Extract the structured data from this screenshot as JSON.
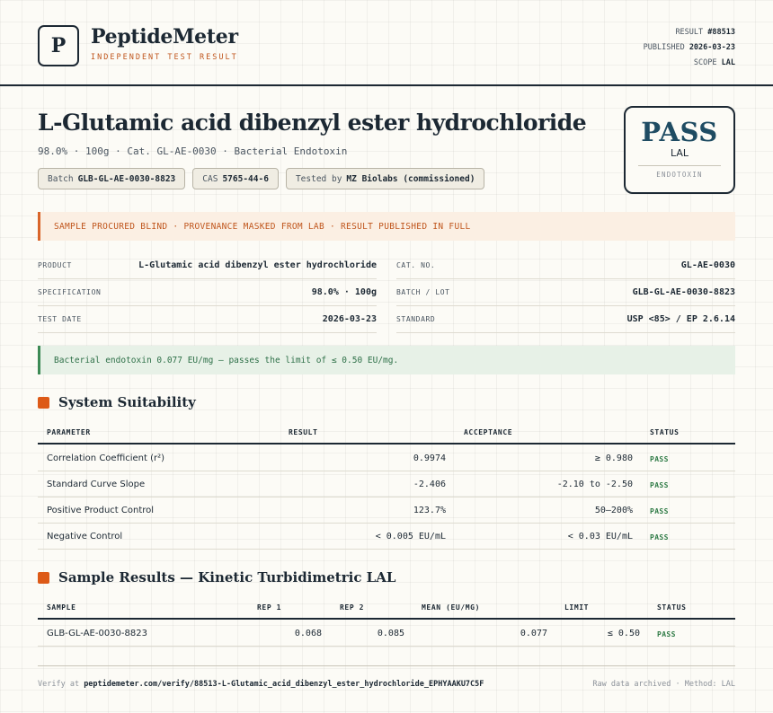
{
  "header": {
    "logo_letter": "P",
    "brand": "PeptideMeter",
    "brand_sub": "INDEPENDENT TEST RESULT",
    "meta": [
      {
        "label": "RESULT",
        "value": "#88513"
      },
      {
        "label": "PUBLISHED",
        "value": "2026-03-23"
      },
      {
        "label": "SCOPE",
        "value": "LAL"
      }
    ]
  },
  "title": "L-Glutamic acid dibenzyl ester hydrochloride",
  "subtitle": "98.0% · 100g · Cat. GL-AE-0030 · Bacterial Endotoxin",
  "chips": [
    {
      "label": "Batch",
      "value": "GLB-GL-AE-0030-8823"
    },
    {
      "label": "CAS",
      "value": "5765-44-6"
    },
    {
      "label": "Tested by",
      "value": "MZ Biolabs (commissioned)"
    }
  ],
  "verdict": {
    "word": "PASS",
    "scope": "LAL",
    "category": "ENDOTOXIN",
    "color": "#1f4c63"
  },
  "notice": "SAMPLE PROCURED BLIND · PROVENANCE MASKED FROM LAB · RESULT PUBLISHED IN FULL",
  "info": {
    "left": [
      {
        "label": "PRODUCT",
        "value": "L-Glutamic acid dibenzyl ester hydrochloride"
      },
      {
        "label": "SPECIFICATION",
        "value": "98.0% · 100g"
      },
      {
        "label": "TEST DATE",
        "value": "2026-03-23"
      }
    ],
    "right": [
      {
        "label": "CAT. NO.",
        "value": "GL-AE-0030"
      },
      {
        "label": "BATCH / LOT",
        "value": "GLB-GL-AE-0030-8823"
      },
      {
        "label": "STANDARD",
        "value": "USP <85> / EP 2.6.14"
      }
    ]
  },
  "result_banner": "Bacterial endotoxin 0.077 EU/mg — passes the limit of ≤ 0.50 EU/mg.",
  "suitability": {
    "title": "System Suitability",
    "headers": [
      "PARAMETER",
      "RESULT",
      "ACCEPTANCE",
      "STATUS"
    ],
    "rows": [
      {
        "parameter": "Correlation Coefficient (r²)",
        "result": "0.9974",
        "acceptance": "≥ 0.980",
        "status": "PASS"
      },
      {
        "parameter": "Standard Curve Slope",
        "result": "-2.406",
        "acceptance": "-2.10 to -2.50",
        "status": "PASS"
      },
      {
        "parameter": "Positive Product Control",
        "result": "123.7%",
        "acceptance": "50–200%",
        "status": "PASS"
      },
      {
        "parameter": "Negative Control",
        "result": "< 0.005 EU/mL",
        "acceptance": "< 0.03 EU/mL",
        "status": "PASS"
      }
    ]
  },
  "samples": {
    "title": "Sample Results — Kinetic Turbidimetric LAL",
    "headers": [
      "SAMPLE",
      "REP 1",
      "REP 2",
      "MEAN (EU/MG)",
      "LIMIT",
      "STATUS"
    ],
    "rows": [
      {
        "sample": "GLB-GL-AE-0030-8823",
        "rep1": "0.068",
        "rep2": "0.085",
        "mean": "0.077",
        "limit": "≤ 0.50",
        "status": "PASS"
      }
    ]
  },
  "footer": {
    "verify_label": "Verify at",
    "verify_url": "peptidemeter.com/verify/88513-L-Glutamic_acid_dibenzyl_ester_hydrochloride_EPHYAAKU7C5F",
    "right": "Raw data archived · Method: LAL"
  },
  "colors": {
    "accent": "#dd5a17",
    "pass": "#2e7a45",
    "ink": "#1c2833"
  }
}
